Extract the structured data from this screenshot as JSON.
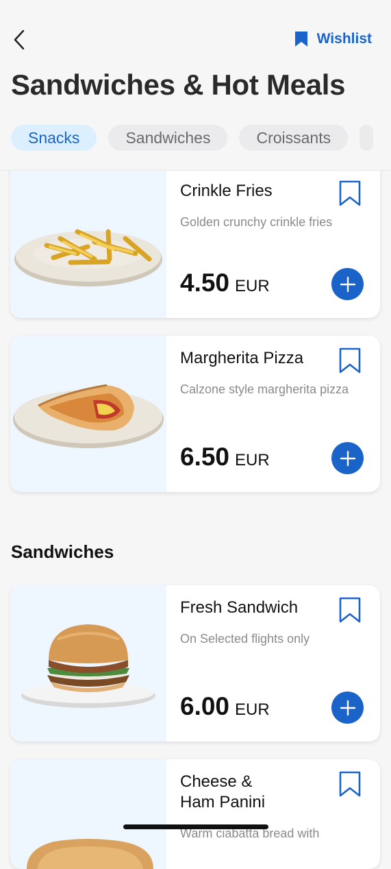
{
  "header": {
    "back_icon": "chevron-left-icon",
    "wishlist_label": "Wishlist",
    "title": "Sandwiches & Hot Meals"
  },
  "tabs": [
    {
      "label": "Snacks",
      "active": true
    },
    {
      "label": "Sandwiches",
      "active": false
    },
    {
      "label": "Croissants",
      "active": false
    }
  ],
  "items": [
    {
      "name": "Crinkle Fries",
      "description": "Golden crunchy crinkle fries",
      "price": "4.50",
      "currency": "EUR",
      "image": "fries"
    },
    {
      "name": "Margherita Pizza",
      "description": "Calzone style margherita pizza",
      "price": "6.50",
      "currency": "EUR",
      "image": "calzone"
    },
    {
      "name": "Fresh Sandwich",
      "description": "On Selected flights only",
      "price": "6.00",
      "currency": "EUR",
      "image": "burger"
    },
    {
      "name": "Cheese & Ham Panini",
      "description": "Warm ciabatta bread with",
      "image": "panini"
    }
  ],
  "sections": {
    "sandwiches": "Sandwiches"
  },
  "colors": {
    "accent": "#1a63c9",
    "tab_active_bg": "#dcefff",
    "image_bg": "#eef6ff"
  }
}
